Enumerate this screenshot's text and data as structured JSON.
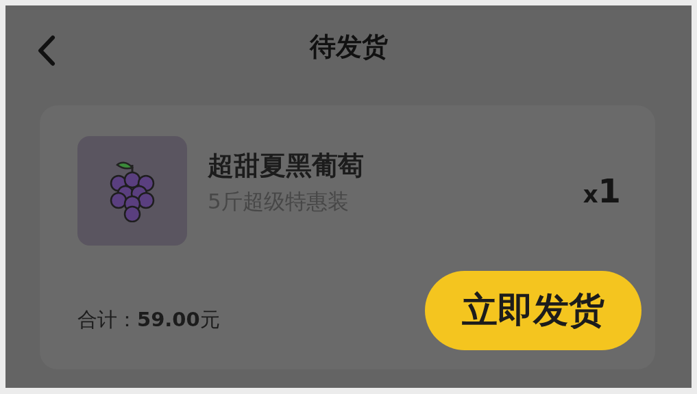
{
  "header": {
    "title": "待发货"
  },
  "order": {
    "name": "超甜夏黑葡萄",
    "spec": "5斤超级特惠装",
    "quantity_prefix": "x",
    "quantity": "1",
    "total": "合计：**59.00**元",
    "action": "立即发货"
  }
}
